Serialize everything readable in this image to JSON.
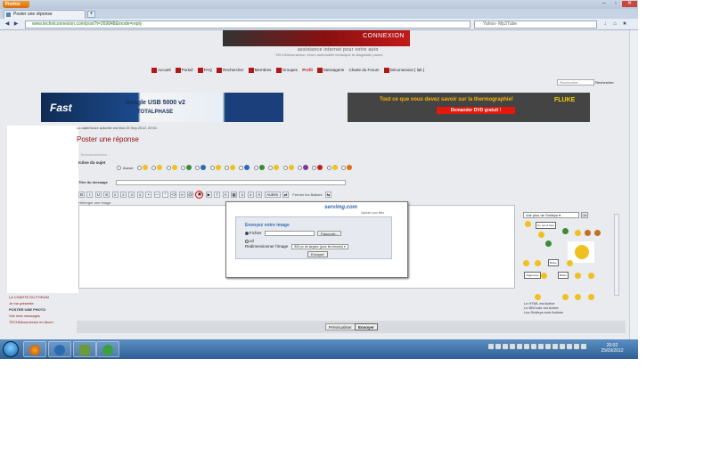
{
  "browser": {
    "app_button": "Firefox",
    "tab_title": "Poster une réponse",
    "new_tab": "+",
    "url": "www.techniconnexion.com/post?t=269848&mode=reply",
    "search_placeholder": "Yahoo- Mp3Tube"
  },
  "site": {
    "logo_text": "CONNEXION",
    "tagline": "assistance internet pour votre auto",
    "subtitle": "TECHNIconnexion, forum automobile technique et diagnostic panne.",
    "menu": [
      "Accueil",
      "Portail",
      "FAQ",
      "Rechercher",
      "Membres",
      "Groupes",
      "Profil",
      "Messagerie",
      "Charte du Forum",
      "Déconnexion [ lab ]"
    ],
    "search_placeholder": "Rechercher...",
    "search_button": "Rechercher"
  },
  "banners": {
    "left": {
      "word": "Fast",
      "model": "Beagle USB 5000 v2",
      "brand": "TOTALPHASE"
    },
    "right": {
      "headline": "Tout ce que vous devez savoir sur la thermographie!",
      "brand": "FLUKE",
      "cta": "Demander DVD gratuit !"
    }
  },
  "form": {
    "date_line": "La date/heure actuelle est Mar 25 Sep 2012, 20:01",
    "page_title": "Poster une réponse",
    "breadcrumb": "Techniconnexion ... ",
    "icon_label": "Icône du sujet",
    "icon_none": "Aucun",
    "title_label": "Titre du message",
    "host_label": "Héberger une image",
    "toolbar_text": {
      "autres": "Autres",
      "fermer": "Fermer les Balises"
    }
  },
  "upload": {
    "logo": "servimg.com",
    "logo_sub": "Upload your files",
    "title": "Envoyez votre image",
    "file_label": "Fichier",
    "browse_button": "Parcourir...",
    "url_label": "url",
    "resize_label": "Redimensionner l'image",
    "resize_value": "800 px de largeur (pour les forums)",
    "send_button": "Envoyer"
  },
  "smileys": {
    "select_label": "Voir plus de Smileys",
    "ok": "Ok",
    "signs": [
      "I'm out of here",
      "Bravo",
      "J'approuve",
      "Bravo"
    ],
    "status": [
      "Le HTML est Activé",
      "Le BBCode est Activé",
      "Les Smileys sont Activés"
    ]
  },
  "sidebar": {
    "links": [
      "LA CHARTE DU FORUM",
      "Je me présente",
      "POSTER UNE PHOTO",
      "Voir mes messages",
      "TECHNIconnexion en favori"
    ]
  },
  "actions": {
    "preview": "Prévisualiser",
    "send": "Envoyer"
  },
  "taskbar": {
    "time": "20:02",
    "date": "25/09/2012"
  }
}
